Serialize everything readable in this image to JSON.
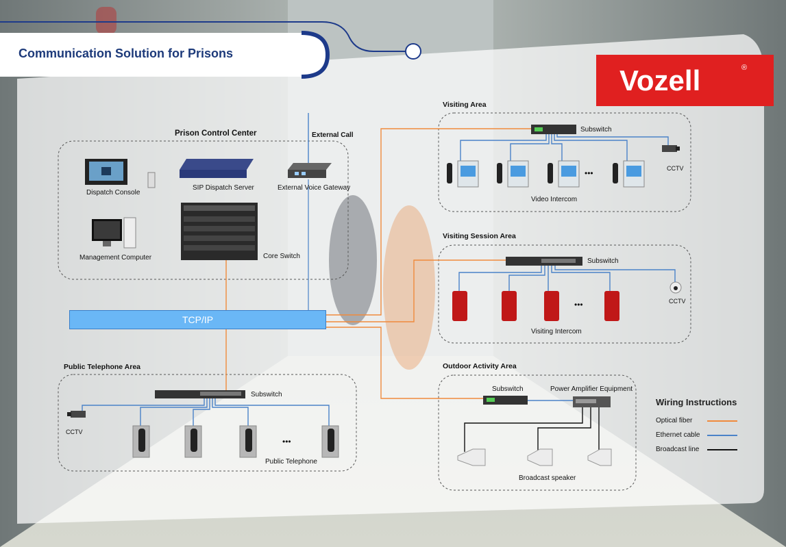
{
  "title": "Communication Solution for Prisons",
  "logo": {
    "text": "Vozell",
    "mark": "®",
    "bg_color": "#e02020"
  },
  "colors": {
    "optical": "#f08a3c",
    "ethernet": "#4a82c8",
    "broadcast": "#111111"
  },
  "backbone": "TCP/IP",
  "control_center": {
    "title": "Prison Control Center",
    "external_call": "External Call",
    "dispatch_console": "Dispatch Console",
    "sip_server": "SIP Dispatch Server",
    "voice_gateway": "External Voice Gateway",
    "management_computer": "Management Computer",
    "core_switch": "Core Switch"
  },
  "visiting_area": {
    "title": "Visiting Area",
    "subswitch": "Subswitch",
    "cctv": "CCTV",
    "ellipsis": "•••",
    "device_label": "Video Intercom"
  },
  "session_area": {
    "title": "Visiting Session Area",
    "subswitch": "Subswitch",
    "cctv": "CCTV",
    "ellipsis": "•••",
    "device_label": "Visiting Intercom"
  },
  "phone_area": {
    "title": "Public Telephone Area",
    "subswitch": "Subswitch",
    "cctv": "CCTV",
    "ellipsis": "•••",
    "device_label": "Public Telephone"
  },
  "outdoor_area": {
    "title": "Outdoor Activity Area",
    "subswitch": "Subswitch",
    "amplifier": "Power Amplifier Equipment",
    "device_label": "Broadcast speaker"
  },
  "wiring": {
    "title": "Wiring Instructions",
    "items": [
      {
        "label": "Optical fiber",
        "color": "#f08a3c"
      },
      {
        "label": "Ethernet cable",
        "color": "#4a82c8"
      },
      {
        "label": "Broadcast line",
        "color": "#111111"
      }
    ]
  }
}
